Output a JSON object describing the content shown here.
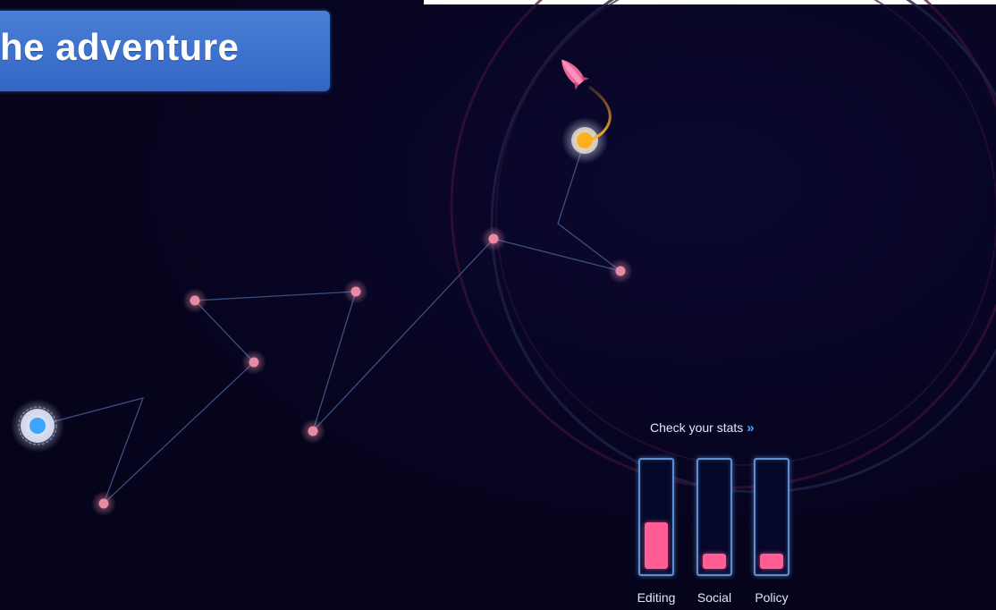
{
  "banner": {
    "text": "he adventure",
    "color": "#3f73cf"
  },
  "map": {
    "line_color": "#3a4f82",
    "node_color": "#e98aa5",
    "start_node_color": "#3aa6ff",
    "current_node_color": "#ffb020",
    "ship_icon": "rocket-icon"
  },
  "stats": {
    "link_label": "Check your stats",
    "link_icon": "double-chevron-right-icon",
    "bar_color": "#ff5d93",
    "bars": [
      {
        "label": "Editing",
        "level": 0.45
      },
      {
        "label": "Social",
        "level": 0.15
      },
      {
        "label": "Policy",
        "level": 0.15
      }
    ]
  }
}
